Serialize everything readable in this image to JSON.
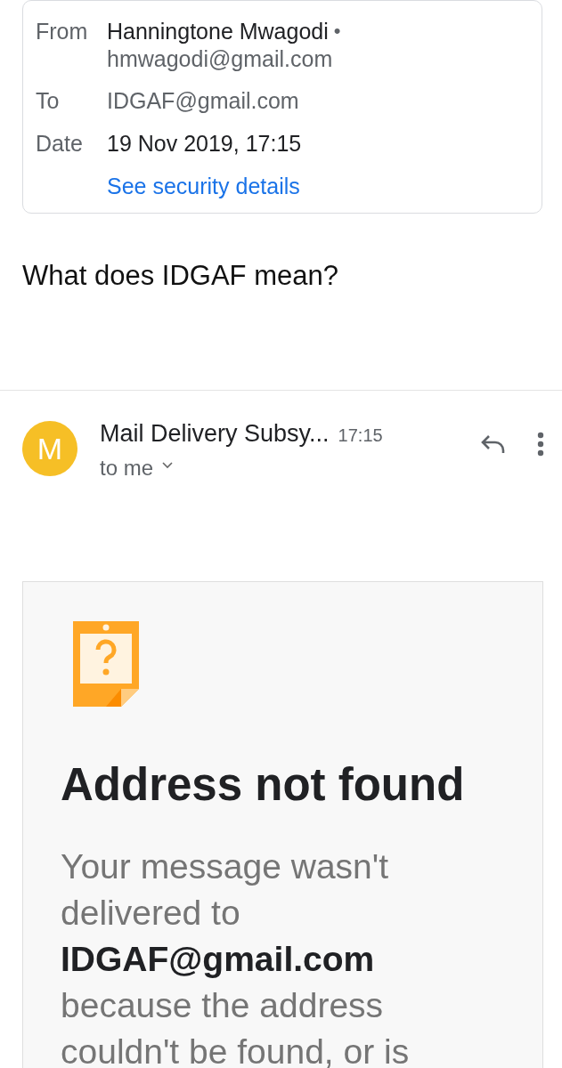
{
  "header_card": {
    "fields": [
      {
        "label": "From",
        "value": "Hanningtone Mwagodi",
        "separator": "•",
        "secondary": "hmwagodi@gmail.com",
        "muted": false
      },
      {
        "label": "To",
        "value": "IDGAF@gmail.com",
        "muted": true
      },
      {
        "label": "Date",
        "value": "19 Nov 2019, 17:15",
        "muted": false
      }
    ],
    "link": "See security details"
  },
  "message_body": "What does IDGAF mean?",
  "reply": {
    "avatar": "M",
    "sender": "Mail Delivery Subsy...",
    "time": "17:15",
    "recipient": "to me"
  },
  "bounce": {
    "title": "Address not found",
    "text": "Your message wasn't delivered to **IDGAF@gmail.com** because the address couldn't be found, or is"
  }
}
